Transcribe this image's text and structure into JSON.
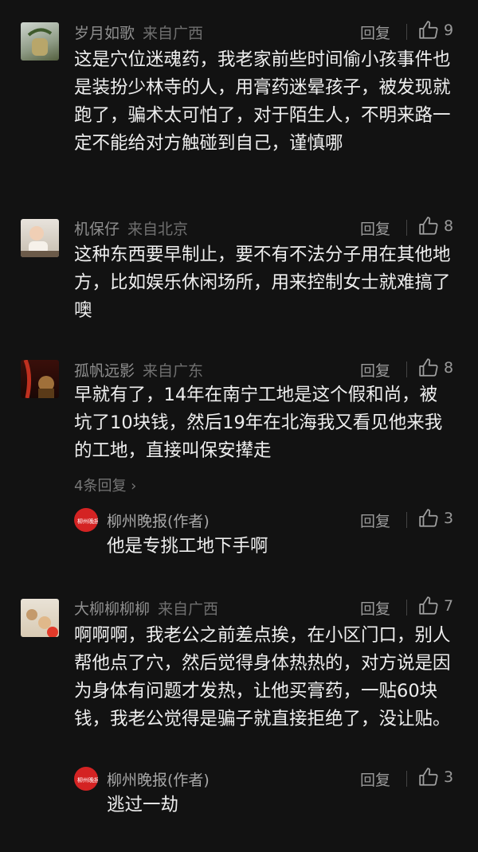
{
  "comments": [
    {
      "name": "岁月如歌",
      "location": "来自广西",
      "reply_label": "回复",
      "likes": "9",
      "text": "这是穴位迷魂药，我老家前些时间偷小孩事件也是装扮少林寺的人，用膏药迷晕孩子，被发现就跑了，骗术太可怕了，对于陌生人，不明来路一定不能给对方触碰到自己，谨慎哪"
    },
    {
      "name": "机保仔",
      "location": "来自北京",
      "reply_label": "回复",
      "likes": "8",
      "text": "这种东西要早制止，要不有不法分子用在其他地方，比如娱乐休闲场所，用来控制女士就难搞了噢"
    },
    {
      "name": "孤帆远影",
      "location": "来自广东",
      "reply_label": "回复",
      "likes": "8",
      "text": "早就有了，14年在南宁工地是这个假和尚，被坑了10块钱，然后19年在北海我又看见他来我的工地，直接叫保安撵走",
      "more_replies": "4条回复",
      "sub_reply": {
        "name": "柳州晚报(作者)",
        "reply_label": "回复",
        "likes": "3",
        "text": "他是专挑工地下手啊"
      }
    },
    {
      "name": "大柳柳柳柳",
      "location": "来自广西",
      "reply_label": "回复",
      "likes": "7",
      "text": "啊啊啊，我老公之前差点挨，在小区门口，别人帮他点了穴，然后觉得身体热热的，对方说是因为身体有问题才发热，让他买膏药，一贴60块钱，我老公觉得是骗子就直接拒绝了，没让贴。",
      "sub_reply": {
        "name": "柳州晚报(作者)",
        "reply_label": "回复",
        "likes": "3",
        "text": "逃过一劫"
      }
    }
  ],
  "icons": {
    "like": "thumbs-up-icon",
    "chevron": "chevron-right-icon"
  },
  "colors": {
    "background": "#121212",
    "author_badge": "#d42323"
  }
}
